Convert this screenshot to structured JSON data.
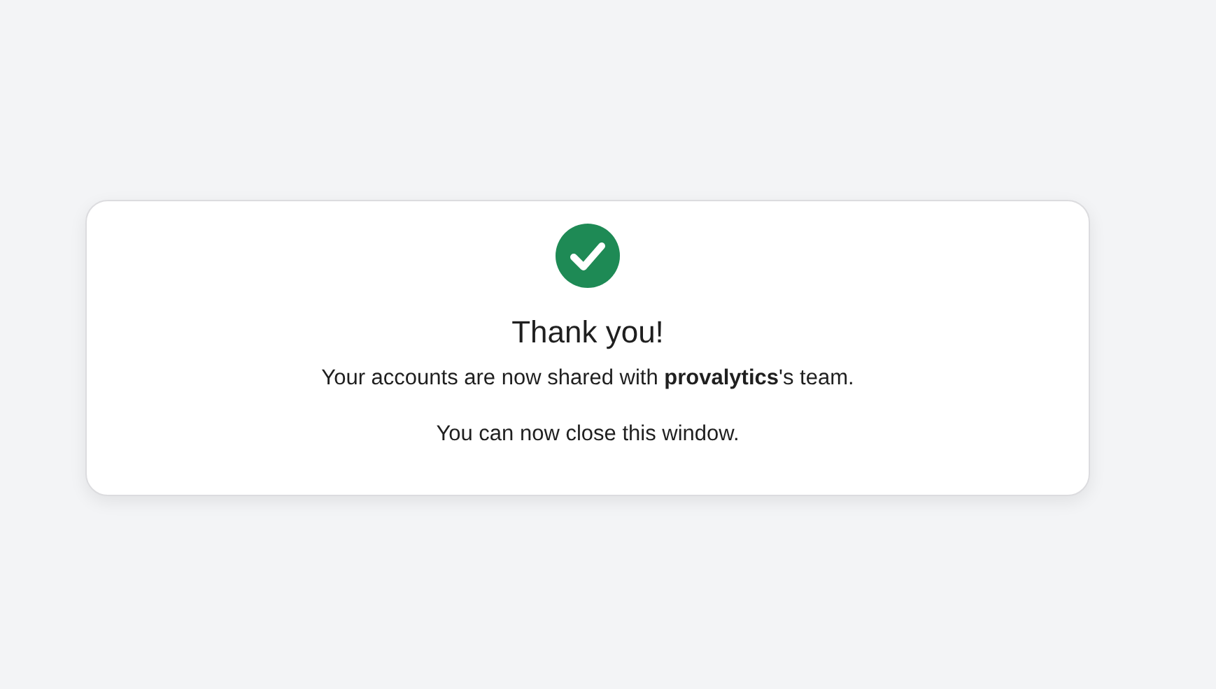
{
  "success": true,
  "title": "Thank you!",
  "message": "Your accounts are now shared with **provalytics**'s team.",
  "note": "You can now close this window."
}
